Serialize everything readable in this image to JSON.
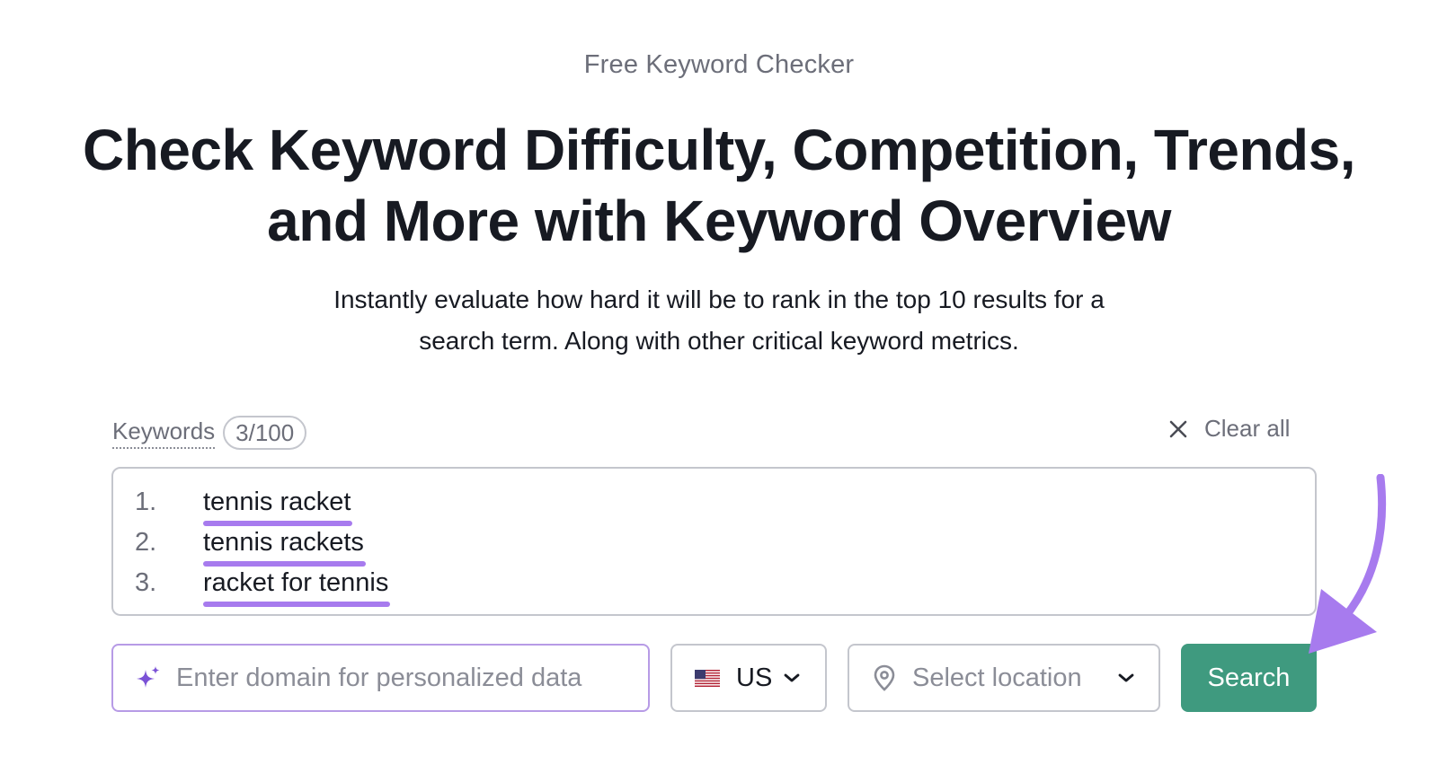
{
  "header": {
    "eyebrow": "Free Keyword Checker",
    "headline_line1": "Check Keyword Difficulty, Competition, Trends,",
    "headline_line2": "and More with Keyword Overview",
    "subtext_line1": "Instantly evaluate how hard it will be to rank in the top 10 results for a",
    "subtext_line2": "search term. Along with other critical keyword metrics."
  },
  "keywords": {
    "label": "Keywords",
    "count": "3/100",
    "clear_all_label": "Clear all",
    "items": [
      {
        "num": "1.",
        "text": "tennis racket"
      },
      {
        "num": "2.",
        "text": "tennis rackets"
      },
      {
        "num": "3.",
        "text": "racket for tennis"
      }
    ]
  },
  "domain": {
    "value": "",
    "placeholder": "Enter domain for personalized data",
    "icon": "sparkle-icon"
  },
  "country": {
    "value": "US",
    "icon": "us-flag-icon"
  },
  "location": {
    "placeholder": "Select location",
    "icon": "location-pin-icon"
  },
  "search": {
    "label": "Search"
  },
  "colors": {
    "accent_purple": "#a77bee",
    "search_green": "#3f9a7f",
    "text_dark": "#171a22",
    "text_muted": "#6c6e79"
  }
}
